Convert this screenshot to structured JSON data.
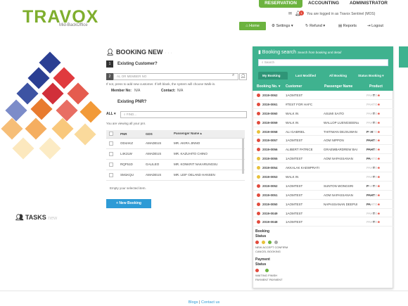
{
  "logo": {
    "text": "TRAVOX",
    "subtitle": "Mid-BackOffice"
  },
  "top_tabs": [
    "RESERVATION",
    "ACCOUNTING",
    "ADMINISTRATOR"
  ],
  "login_text": "You are logged in as Travox Sentinel (MOS)",
  "notification_count": "1",
  "nav": {
    "home": "Home",
    "settings": "Settings",
    "refund": "Refund",
    "reports": "Reports",
    "logout": "Logout"
  },
  "booking_new": {
    "title": "BOOKING NEW",
    "existing_customer": "Existing Customer?",
    "step1": "1",
    "step2": "2",
    "member_placeholder": "AL OR MEMBER NO",
    "hint": "If not, press to add new customer. If left blank, the system will choose Walk-in.",
    "member_no_label": "Member No:",
    "member_no_value": "N/A",
    "contact_label": "Contact:",
    "contact_value": "N/A",
    "existing_pnr": "Existing PNR?",
    "filter_all": "ALL",
    "find_placeholder": "FIND...",
    "viewing": "You are viewing all your pnr.",
    "columns": [
      "PNR",
      "GDS",
      "Passenger Name"
    ],
    "rows": [
      {
        "pnr": "OD4AKZ",
        "gds": "AMADEUS",
        "name": "MR. AKIRA JINNO"
      },
      {
        "pnr": "L4K2LW",
        "gds": "AMADEUS",
        "name": "MR. KAZUHITO CHINO"
      },
      {
        "pnr": "RQF51D",
        "gds": "GALILEO",
        "name": "MR. KONKRIT NAKARUNGSU"
      },
      {
        "pnr": "SM1KQU",
        "gds": "AMADEUS",
        "name": "MR. LEIF OELAND HANSEN"
      }
    ],
    "empty_msg": "Empty your selected item.",
    "new_booking_btn": "New Booking"
  },
  "tasks": {
    "title": "TASKS",
    "faint": "new"
  },
  "booking_search": {
    "title": "Booking search",
    "subtitle": "Search from booking and detail",
    "search_placeholder": "Search",
    "tabs": [
      "My Booking",
      "Last Modified",
      "All Booking",
      "Status Booking"
    ],
    "columns": [
      "Booking No.",
      "Customer",
      "Passenger Name",
      "Product"
    ],
    "rows": [
      {
        "no": "2019-0062",
        "customer": "1AOMTEST",
        "pax": "",
        "dot": "#e24a3c",
        "p": "gggk"
      },
      {
        "no": "2019-0061",
        "customer": "#TEST FOR HAFC",
        "pax": "",
        "dot": "#e24a3c",
        "p": "gggg"
      },
      {
        "no": "2019-0060",
        "customer": "WALK IN",
        "pax": "ASUMI SAITO",
        "dot": "#e24a3c",
        "p": "gggk"
      },
      {
        "no": "2019-0059",
        "customer": "WALK IN",
        "pax": "WALLOP LUENGSEENu",
        "dot": "#e24a3c",
        "p": "gggk"
      },
      {
        "no": "2019-0058",
        "customer": "ALI GABRIEL",
        "pax": "THITIWAN DEJSUWAN",
        "dot": "#e8c13a",
        "p": "kgkg"
      },
      {
        "no": "2019-0057",
        "customer": "1AOMTEST",
        "pax": "AOM NIPPON",
        "dot": "#e24a3c",
        "p": "kkkk"
      },
      {
        "no": "2019-0056",
        "customer": "ALIBERT PATRICE",
        "pax": "GRAEMBARDREW BAI",
        "dot": "#e24a3c",
        "p": "kkkk"
      },
      {
        "no": "2019-0055",
        "customer": "1AOMTEST",
        "pax": "AOM NAPASSANAN",
        "dot": "#e8c13a",
        "p": "kkgg"
      },
      {
        "no": "2019-0054",
        "customer": "AKKALAK KAEWPRATI",
        "pax": "",
        "dot": "#e8c13a",
        "p": "gggk"
      },
      {
        "no": "2019-0053",
        "customer": "WALK IN",
        "pax": "",
        "dot": "#e8c13a",
        "p": "gggk"
      },
      {
        "no": "2019-0052",
        "customer": "1AOMTEST",
        "pax": "SUNTON WONGSRI",
        "dot": "#e24a3c",
        "p": "kggk"
      },
      {
        "no": "2019-0051",
        "customer": "1AOMTEST",
        "pax": "AOM NAPASSANAN",
        "dot": "#e24a3c",
        "p": "kkkk"
      },
      {
        "no": "2019-0050",
        "customer": "1AOMTEST",
        "pax": "NAPASSANAN DEEPUI",
        "dot": "#e24a3c",
        "p": "kkgg"
      },
      {
        "no": "2019-0049",
        "customer": "1AOMTEST",
        "pax": "",
        "dot": "#e24a3c",
        "p": "gggk"
      },
      {
        "no": "2019-0048",
        "customer": "1AOMTEST",
        "pax": "",
        "dot": "#e24a3c",
        "p": "gggk"
      }
    ],
    "product_letters": [
      "P",
      "A",
      "H",
      "T",
      "O"
    ],
    "legend_booking_title": "Booking Status",
    "legend_booking_text": "NEW ACCEPT CONFIRM CANCEL BOOKING",
    "legend_payment_title": "Payment Status",
    "legend_payment_text": "WAITING FINISH PAYMENT PAYMENT"
  },
  "footer": {
    "blogs": "Blogs",
    "sep": "|",
    "contact": "Contact us"
  }
}
